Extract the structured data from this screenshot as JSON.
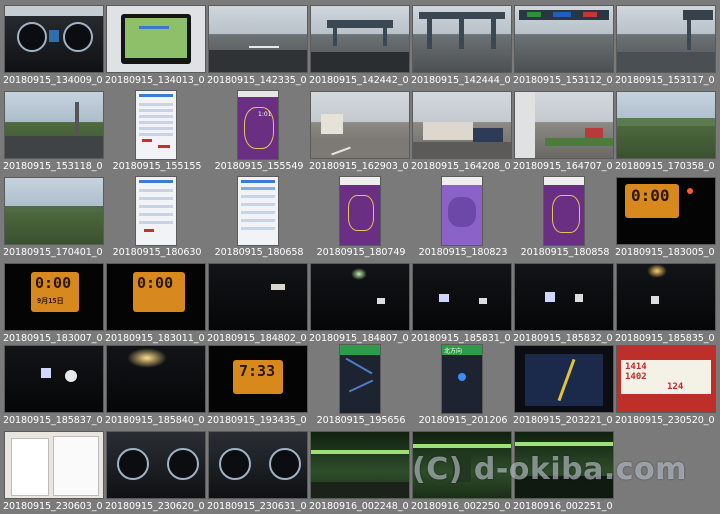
{
  "gallery": {
    "items": [
      {
        "caption": "20180915_134009_0"
      },
      {
        "caption": "20180915_134013_0"
      },
      {
        "caption": "20180915_142335_0"
      },
      {
        "caption": "20180915_142442_0"
      },
      {
        "caption": "20180915_142444_0"
      },
      {
        "caption": "20180915_153112_0"
      },
      {
        "caption": "20180915_153117_0"
      },
      {
        "caption": "20180915_153118_0"
      },
      {
        "caption": "20180915_155155"
      },
      {
        "caption": "20180915_155549"
      },
      {
        "caption": "20180915_162903_0"
      },
      {
        "caption": "20180915_164208_0"
      },
      {
        "caption": "20180915_164707_0"
      },
      {
        "caption": "20180915_170358_0"
      },
      {
        "caption": "20180915_170401_0"
      },
      {
        "caption": "20180915_180630"
      },
      {
        "caption": "20180915_180658"
      },
      {
        "caption": "20180915_180749"
      },
      {
        "caption": "20180915_180823"
      },
      {
        "caption": "20180915_180858"
      },
      {
        "caption": "20180915_183005_0"
      },
      {
        "caption": "20180915_183007_0"
      },
      {
        "caption": "20180915_183011_0"
      },
      {
        "caption": "20180915_184802_0"
      },
      {
        "caption": "20180915_184807_0"
      },
      {
        "caption": "20180915_185831_0"
      },
      {
        "caption": "20180915_185832_0"
      },
      {
        "caption": "20180915_185835_0"
      },
      {
        "caption": "20180915_185837_0"
      },
      {
        "caption": "20180915_185840_0"
      },
      {
        "caption": "20180915_193435_0"
      },
      {
        "caption": "20180915_195656"
      },
      {
        "caption": "20180915_201206"
      },
      {
        "caption": "20180915_203221_0"
      },
      {
        "caption": "20180915_230520_0"
      },
      {
        "caption": "20180915_230603_0"
      },
      {
        "caption": "20180915_230620_0"
      },
      {
        "caption": "20180915_230631_0"
      },
      {
        "caption": "20180916_002248_0"
      },
      {
        "caption": "20180916_002250_0"
      },
      {
        "caption": "20180916_002251_0"
      }
    ],
    "display_texts": {
      "clock_a": "0:00",
      "clock_b": "0:00",
      "clock_c": "0:00",
      "clock_d": "7:33",
      "clock_date": "9月15日",
      "map_label": "1:01",
      "prices": [
        "1414",
        "1402",
        "124"
      ],
      "nav_banner": "北方向"
    },
    "watermark": "(C) d-okiba.com",
    "colors": {
      "background": "#7a7a7a",
      "caption": "#ffffff",
      "led": "#ffcf66",
      "map_purple": "#6a2f83"
    }
  }
}
